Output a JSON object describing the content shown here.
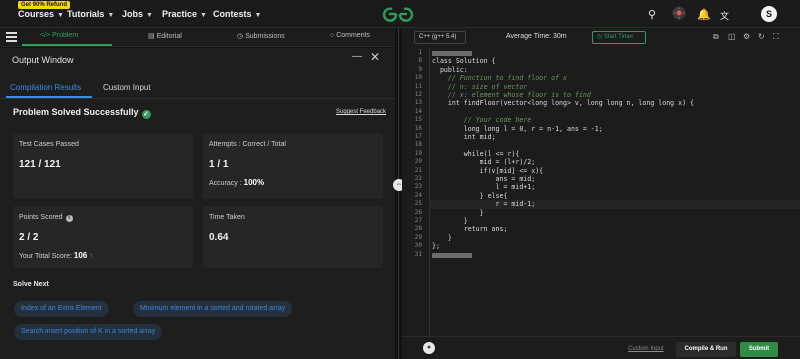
{
  "topnav": {
    "promo": "Get 90% Refund",
    "items": [
      {
        "label": "Courses"
      },
      {
        "label": "Tutorials"
      },
      {
        "label": "Jobs"
      },
      {
        "label": "Practice"
      },
      {
        "label": "Contests"
      }
    ],
    "avatar_letter": "S"
  },
  "problem_tabs": [
    {
      "label": "Problem"
    },
    {
      "label": "Editorial"
    },
    {
      "label": "Submissions"
    },
    {
      "label": "Comments"
    }
  ],
  "output_window": {
    "title": "Output Window",
    "subtabs": [
      {
        "label": "Compilation Results"
      },
      {
        "label": "Custom Input"
      }
    ],
    "status": "Problem Solved Successfully",
    "feedback_link": "Suggest Feedback",
    "cards": {
      "test_cases": {
        "label": "Test Cases Passed",
        "value": "121 / 121"
      },
      "attempts": {
        "label": "Attempts : Correct / Total",
        "value": "1 / 1",
        "sub_label": "Accuracy :",
        "sub_value": "100%"
      },
      "points": {
        "label": "Points Scored",
        "value": "2 / 2",
        "sub_label": "Your Total Score:",
        "sub_value": "106"
      },
      "time": {
        "label": "Time Taken",
        "value": "0.64"
      }
    },
    "solve_next": {
      "title": "Solve Next",
      "items": [
        {
          "label": "Index of an Extra Element"
        },
        {
          "label": "Minimum element in a sorted and rotated array"
        },
        {
          "label": "Search insert position of K in a sorted array"
        }
      ]
    }
  },
  "editor_bar": {
    "language": "C++ (g++ 5.4)",
    "avg_time": "Average Time: 30m",
    "timer_label": "Start Timer"
  },
  "editor": {
    "line_numbers": [
      "1",
      "8",
      "9",
      "10",
      "11",
      "12",
      "13",
      "14",
      "15",
      "16",
      "17",
      "18",
      "19",
      "20",
      "21",
      "22",
      "23",
      "24",
      "25",
      "26",
      "27",
      "28",
      "29",
      "30",
      "31"
    ],
    "lines": [
      "",
      "class Solution {",
      "  public:",
      "    // Function to find floor of x",
      "    // n: size of vector",
      "    // x: element whose floor is to find",
      "    int findFloor(vector<long long> v, long long n, long long x) {",
      "",
      "        // Your code here",
      "        long long l = 0, r = n-1, ans = -1;",
      "        int mid;",
      "",
      "        while(l <= r){",
      "            mid = (l+r)/2;",
      "            if(v[mid] <= x){",
      "                ans = mid;",
      "                l = mid+1;",
      "            } else{",
      "                r = mid-1;",
      "            }",
      "        }",
      "        return ans;",
      "    }",
      "};",
      "",
      ""
    ]
  },
  "bottom_bar": {
    "custom_input": "Custom Input",
    "compile_label": "Compile & Run",
    "submit_label": "Submit"
  }
}
